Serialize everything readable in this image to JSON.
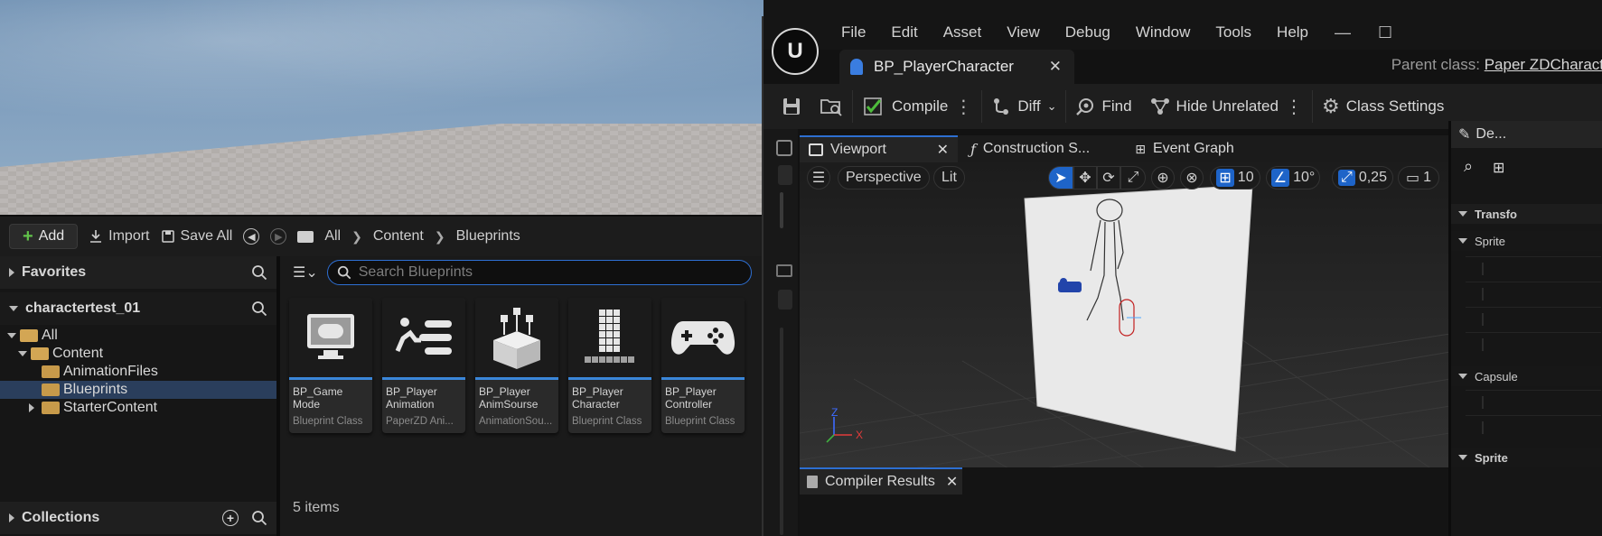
{
  "content_browser": {
    "toolbar": {
      "add": "Add",
      "import": "Import",
      "save_all": "Save All"
    },
    "breadcrumb": [
      "All",
      "Content",
      "Blueprints"
    ],
    "favorites": "Favorites",
    "project": "charactertest_01",
    "tree": [
      "All",
      "Content",
      "AnimationFiles",
      "Blueprints",
      "StarterContent"
    ],
    "collections": "Collections",
    "search_placeholder": "Search Blueprints",
    "assets": [
      {
        "name1": "BP_Game",
        "name2": "Mode",
        "type": "Blueprint Class",
        "icon": "gamemode-icon"
      },
      {
        "name1": "BP_Player",
        "name2": "Animation",
        "type": "PaperZD Ani...",
        "icon": "animation-icon"
      },
      {
        "name1": "BP_Player",
        "name2": "AnimSourse",
        "type": "AnimationSou...",
        "icon": "animsource-icon"
      },
      {
        "name1": "BP_Player",
        "name2": "Character",
        "type": "Blueprint Class",
        "icon": "character-icon"
      },
      {
        "name1": "BP_Player",
        "name2": "Controller",
        "type": "Blueprint Class",
        "icon": "controller-icon"
      }
    ],
    "item_count": "5 items"
  },
  "editor": {
    "menu": [
      "File",
      "Edit",
      "Asset",
      "View",
      "Debug",
      "Window",
      "Tools",
      "Help"
    ],
    "doc_tab": "BP_PlayerCharacter",
    "parent_class_label": "Parent class:",
    "parent_class_value": "Paper ZDCharact",
    "toolbar": {
      "compile": "Compile",
      "diff": "Diff",
      "find": "Find",
      "hide_unrelated": "Hide Unrelated",
      "class_settings": "Class Settings"
    },
    "tabs": {
      "viewport": "Viewport",
      "construction": "Construction S...",
      "event_graph": "Event Graph",
      "details": "De..."
    },
    "viewport": {
      "perspective": "Perspective",
      "lit": "Lit",
      "grid_snap": "10",
      "rotation_snap": "10°",
      "scale_snap": "0,25",
      "camera_speed": "1",
      "axis_z": "Z",
      "axis_x": "X"
    },
    "compiler_results": "Compiler Results",
    "details_sections": [
      "Transfo",
      "Sprite",
      "Capsule",
      "Sprite"
    ]
  },
  "colors": {
    "accent": "#2d6fd1",
    "selection": "#2a3e5c",
    "add_plus": "#61c14a",
    "folder": "#c79a4a"
  }
}
